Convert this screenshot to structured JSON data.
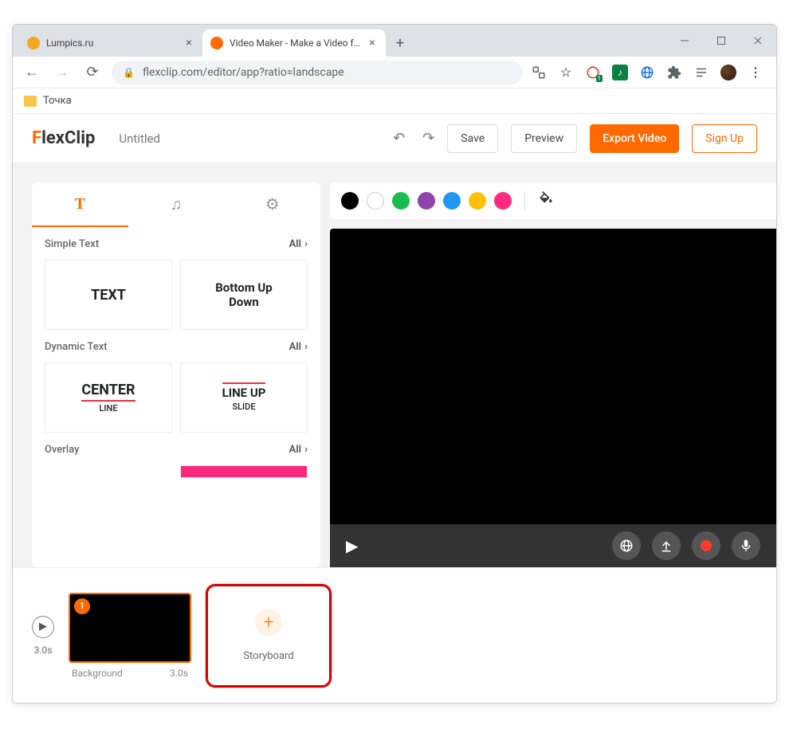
{
  "browser": {
    "tabs": [
      {
        "title": "Lumpics.ru",
        "favicon_color": "#f5a623"
      },
      {
        "title": "Video Maker - Make a Video for",
        "favicon_color": "#ff6a00"
      }
    ],
    "url": "flexclip.com/editor/app?ratio=landscape",
    "bookmark": "Точка"
  },
  "header": {
    "logo_prefix": "F",
    "logo_rest": "lexClip",
    "project_title": "Untitled",
    "save": "Save",
    "preview": "Preview",
    "export": "Export Video",
    "signup": "Sign Up"
  },
  "palette": {
    "colors": [
      "#000000",
      "#ffffff",
      "#1abc52",
      "#8e44ad",
      "#2196f3",
      "#ffc107",
      "#ff2a7e"
    ]
  },
  "panel": {
    "sections": [
      {
        "title": "Simple Text",
        "more": "All",
        "thumbs": [
          {
            "main": "TEXT"
          },
          {
            "main": "Bottom Up",
            "sub": "Down"
          }
        ]
      },
      {
        "title": "Dynamic Text",
        "more": "All",
        "thumbs": [
          {
            "main": "CENTER",
            "sub": "LINE"
          },
          {
            "main": "LINE UP",
            "sub": "SLIDE"
          }
        ]
      },
      {
        "title": "Overlay",
        "more": "All"
      }
    ]
  },
  "timeline": {
    "total": "3.0s",
    "clip": {
      "badge": "1",
      "name": "Background",
      "duration": "3.0s"
    },
    "add_label": "Storyboard"
  }
}
